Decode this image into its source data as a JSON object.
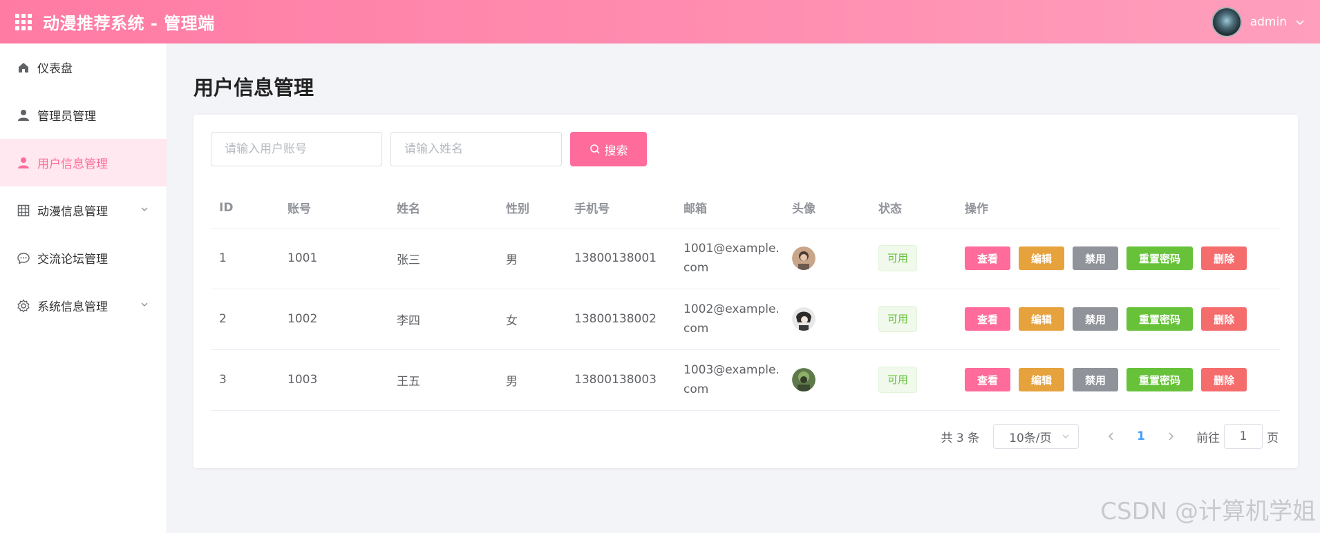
{
  "header": {
    "title": "动漫推荐系统 - 管理端",
    "username": "admin"
  },
  "sidebar": {
    "items": [
      {
        "label": "仪表盘",
        "icon": "home-icon",
        "active": false,
        "expandable": false
      },
      {
        "label": "管理员管理",
        "icon": "user-icon",
        "active": false,
        "expandable": false
      },
      {
        "label": "用户信息管理",
        "icon": "user-icon",
        "active": true,
        "expandable": false
      },
      {
        "label": "动漫信息管理",
        "icon": "grid-table-icon",
        "active": false,
        "expandable": true
      },
      {
        "label": "交流论坛管理",
        "icon": "chat-icon",
        "active": false,
        "expandable": false
      },
      {
        "label": "系统信息管理",
        "icon": "gear-icon",
        "active": false,
        "expandable": true
      }
    ]
  },
  "main": {
    "page_title": "用户信息管理",
    "search": {
      "account_placeholder": "请输入用户账号",
      "name_placeholder": "请输入姓名",
      "button_label": "搜索"
    },
    "table": {
      "columns": [
        "ID",
        "账号",
        "姓名",
        "性别",
        "手机号",
        "邮箱",
        "头像",
        "状态",
        "操作"
      ],
      "rows": [
        {
          "id": "1",
          "account": "1001",
          "name": "张三",
          "gender": "男",
          "phone": "13800138001",
          "email_1": "1001@example.",
          "email_2": "com",
          "status": "可用"
        },
        {
          "id": "2",
          "account": "1002",
          "name": "李四",
          "gender": "女",
          "phone": "13800138002",
          "email_1": "1002@example.",
          "email_2": "com",
          "status": "可用"
        },
        {
          "id": "3",
          "account": "1003",
          "name": "王五",
          "gender": "男",
          "phone": "13800138003",
          "email_1": "1003@example.",
          "email_2": "com",
          "status": "可用"
        }
      ],
      "actions": {
        "view": "查看",
        "edit": "编辑",
        "disable": "禁用",
        "reset_password": "重置密码",
        "delete": "删除"
      }
    },
    "pagination": {
      "total_text": "共 3 条",
      "page_size": "10条/页",
      "current_page": "1",
      "goto_label": "前往",
      "goto_value": "1",
      "page_suffix": "页"
    }
  },
  "watermark": "CSDN @计算机学姐",
  "colors": {
    "accent": "#ff6b9a",
    "edit": "#e6a23c",
    "disable": "#909399",
    "reset": "#67c23a",
    "delete": "#f56c6c",
    "status_ok": "#67c23a"
  }
}
